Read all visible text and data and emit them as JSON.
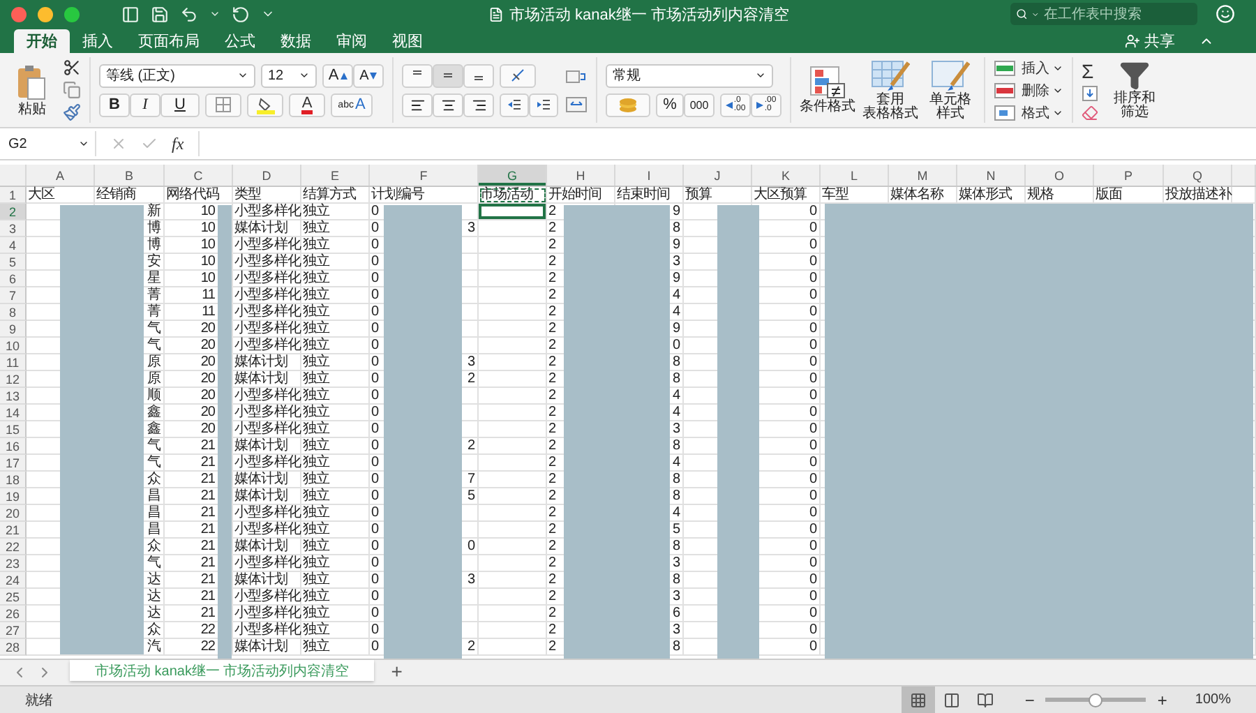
{
  "window": {
    "title": "市场活动 kanak继一 市场活动列内容清空"
  },
  "search": {
    "placeholder": "在工作表中搜索"
  },
  "ribbon_tabs": [
    {
      "label": "开始",
      "selected": true
    },
    {
      "label": "插入",
      "selected": false
    },
    {
      "label": "页面布局",
      "selected": false
    },
    {
      "label": "公式",
      "selected": false
    },
    {
      "label": "数据",
      "selected": false
    },
    {
      "label": "审阅",
      "selected": false
    },
    {
      "label": "视图",
      "selected": false
    }
  ],
  "share": {
    "label": "共享"
  },
  "clipboard": {
    "paste": "粘贴"
  },
  "font": {
    "name": "等线 (正文)",
    "size": "12",
    "grow_letter": "A",
    "shrink_letter": "A",
    "bold": "B",
    "italic": "I",
    "underline": "U",
    "color_letter": "A",
    "phonetic": "abc",
    "phonetic_letter": "A"
  },
  "number": {
    "format": "常规",
    "percent": "%",
    "comma": "000",
    "increase_decimal": [
      ".0",
      ".00"
    ],
    "decrease_decimal": [
      ".00",
      ".0"
    ]
  },
  "styles": [
    {
      "lines": [
        "条件格式"
      ],
      "kind": "conditional"
    },
    {
      "lines": [
        "套用",
        "表格格式"
      ],
      "kind": "table"
    },
    {
      "lines": [
        "单元格",
        "样式"
      ],
      "kind": "cell"
    }
  ],
  "cells_group": [
    {
      "label": "插入",
      "kind": "insert"
    },
    {
      "label": "删除",
      "kind": "delete"
    },
    {
      "label": "格式",
      "kind": "format"
    }
  ],
  "editing": {
    "sum": "Σ",
    "sort_filter": [
      "排序和",
      "筛选"
    ]
  },
  "formula_bar": {
    "name_box": "G2",
    "fx": "fx"
  },
  "columns": [
    {
      "letter": "A",
      "kind": "text",
      "selected": false
    },
    {
      "letter": "B",
      "kind": "text",
      "selected": false
    },
    {
      "letter": "C",
      "kind": "number",
      "selected": false
    },
    {
      "letter": "D",
      "kind": "text",
      "selected": false
    },
    {
      "letter": "E",
      "kind": "text",
      "selected": false
    },
    {
      "letter": "F",
      "kind": "text",
      "selected": false
    },
    {
      "letter": "G",
      "kind": "text",
      "selected": true
    },
    {
      "letter": "H",
      "kind": "text",
      "selected": false
    },
    {
      "letter": "I",
      "kind": "number",
      "selected": false
    },
    {
      "letter": "J",
      "kind": "text",
      "selected": false
    },
    {
      "letter": "K",
      "kind": "number",
      "selected": false
    },
    {
      "letter": "L",
      "kind": "text",
      "selected": false
    },
    {
      "letter": "M",
      "kind": "text",
      "selected": false
    },
    {
      "letter": "N",
      "kind": "text",
      "selected": false
    },
    {
      "letter": "O",
      "kind": "text",
      "selected": false
    },
    {
      "letter": "P",
      "kind": "text",
      "selected": false
    },
    {
      "letter": "Q",
      "kind": "text",
      "selected": false
    }
  ],
  "rows": [
    {
      "row": "1",
      "selected": false,
      "cells": [
        "大区",
        "经销商",
        "网络代码",
        "类型",
        "结算方式",
        "计划编号",
        "市场活动",
        "开始时间",
        "结束时间",
        "预算",
        "大区预算",
        "车型",
        "媒体名称",
        "媒体形式",
        "规格",
        "版面",
        "投放描述补"
      ]
    },
    {
      "row": "2",
      "selected": true,
      "cells": [
        null,
        "新",
        "10",
        "小型多样化",
        "独立",
        "0",
        null,
        "2",
        "9",
        null,
        "0"
      ]
    },
    {
      "row": "3",
      "selected": false,
      "cells": [
        null,
        "博",
        "10",
        "媒体计划",
        "独立",
        "0",
        null,
        "2",
        "8",
        null,
        "0"
      ],
      "plan_code_tail": "3"
    },
    {
      "row": "4",
      "selected": false,
      "cells": [
        null,
        "博",
        "10",
        "小型多样化",
        "独立",
        "0",
        null,
        "2",
        "9",
        null,
        "0"
      ]
    },
    {
      "row": "5",
      "selected": false,
      "cells": [
        null,
        "安",
        "10",
        "小型多样化",
        "独立",
        "0",
        null,
        "2",
        "3",
        null,
        "0"
      ]
    },
    {
      "row": "6",
      "selected": false,
      "cells": [
        null,
        "星",
        "10",
        "小型多样化",
        "独立",
        "0",
        null,
        "2",
        "9",
        null,
        "0"
      ]
    },
    {
      "row": "7",
      "selected": false,
      "cells": [
        null,
        "菁",
        "11",
        "小型多样化",
        "独立",
        "0",
        null,
        "2",
        "4",
        null,
        "0"
      ]
    },
    {
      "row": "8",
      "selected": false,
      "cells": [
        null,
        "菁",
        "11",
        "小型多样化",
        "独立",
        "0",
        null,
        "2",
        "4",
        null,
        "0"
      ]
    },
    {
      "row": "9",
      "selected": false,
      "cells": [
        null,
        "气",
        "20",
        "小型多样化",
        "独立",
        "0",
        null,
        "2",
        "9",
        null,
        "0"
      ]
    },
    {
      "row": "10",
      "selected": false,
      "cells": [
        null,
        "气",
        "20",
        "小型多样化",
        "独立",
        "0",
        null,
        "2",
        "0",
        null,
        "0"
      ]
    },
    {
      "row": "11",
      "selected": false,
      "cells": [
        null,
        "原",
        "20",
        "媒体计划",
        "独立",
        "0",
        null,
        "2",
        "8",
        null,
        "0"
      ],
      "plan_code_tail": "3"
    },
    {
      "row": "12",
      "selected": false,
      "cells": [
        null,
        "原",
        "20",
        "媒体计划",
        "独立",
        "0",
        null,
        "2",
        "8",
        null,
        "0"
      ],
      "plan_code_tail": "2"
    },
    {
      "row": "13",
      "selected": false,
      "cells": [
        null,
        "顺",
        "20",
        "小型多样化",
        "独立",
        "0",
        null,
        "2",
        "4",
        null,
        "0"
      ]
    },
    {
      "row": "14",
      "selected": false,
      "cells": [
        null,
        "鑫",
        "20",
        "小型多样化",
        "独立",
        "0",
        null,
        "2",
        "4",
        null,
        "0"
      ]
    },
    {
      "row": "15",
      "selected": false,
      "cells": [
        null,
        "鑫",
        "20",
        "小型多样化",
        "独立",
        "0",
        null,
        "2",
        "3",
        null,
        "0"
      ]
    },
    {
      "row": "16",
      "selected": false,
      "cells": [
        null,
        "气",
        "21",
        "媒体计划",
        "独立",
        "0",
        null,
        "2",
        "8",
        null,
        "0"
      ],
      "plan_code_tail": "2"
    },
    {
      "row": "17",
      "selected": false,
      "cells": [
        null,
        "气",
        "21",
        "小型多样化",
        "独立",
        "0",
        null,
        "2",
        "4",
        null,
        "0"
      ]
    },
    {
      "row": "18",
      "selected": false,
      "cells": [
        null,
        "众",
        "21",
        "媒体计划",
        "独立",
        "0",
        null,
        "2",
        "8",
        null,
        "0"
      ],
      "plan_code_tail": "7"
    },
    {
      "row": "19",
      "selected": false,
      "cells": [
        null,
        "昌",
        "21",
        "媒体计划",
        "独立",
        "0",
        null,
        "2",
        "8",
        null,
        "0"
      ],
      "plan_code_tail": "5"
    },
    {
      "row": "20",
      "selected": false,
      "cells": [
        null,
        "昌",
        "21",
        "小型多样化",
        "独立",
        "0",
        null,
        "2",
        "4",
        null,
        "0"
      ]
    },
    {
      "row": "21",
      "selected": false,
      "cells": [
        null,
        "昌",
        "21",
        "小型多样化",
        "独立",
        "0",
        null,
        "2",
        "5",
        null,
        "0"
      ]
    },
    {
      "row": "22",
      "selected": false,
      "cells": [
        null,
        "众",
        "21",
        "媒体计划",
        "独立",
        "0",
        null,
        "2",
        "8",
        null,
        "0"
      ],
      "plan_code_tail": "0"
    },
    {
      "row": "23",
      "selected": false,
      "cells": [
        null,
        "气",
        "21",
        "小型多样化",
        "独立",
        "0",
        null,
        "2",
        "3",
        null,
        "0"
      ]
    },
    {
      "row": "24",
      "selected": false,
      "cells": [
        null,
        "达",
        "21",
        "媒体计划",
        "独立",
        "0",
        null,
        "2",
        "8",
        null,
        "0"
      ],
      "plan_code_tail": "3"
    },
    {
      "row": "25",
      "selected": false,
      "cells": [
        null,
        "达",
        "21",
        "小型多样化",
        "独立",
        "0",
        null,
        "2",
        "3",
        null,
        "0"
      ]
    },
    {
      "row": "26",
      "selected": false,
      "cells": [
        null,
        "达",
        "21",
        "小型多样化",
        "独立",
        "0",
        null,
        "2",
        "6",
        null,
        "0"
      ]
    },
    {
      "row": "27",
      "selected": false,
      "cells": [
        null,
        "众",
        "22",
        "小型多样化",
        "独立",
        "0",
        null,
        "2",
        "3",
        null,
        "0"
      ]
    },
    {
      "row": "28",
      "selected": false,
      "cells": [
        null,
        "汽",
        "22",
        "媒体计划",
        "独立",
        "0",
        null,
        "2",
        "8",
        null,
        "0"
      ],
      "plan_code_tail": "2"
    }
  ],
  "sheet_tabs": [
    {
      "label": "市场活动 kanak继一 市场活动列内容清空",
      "selected": true
    }
  ],
  "add_sheet": "+",
  "status_bar": {
    "status": "就绪",
    "views": [
      {
        "kind": "normal",
        "selected": true
      },
      {
        "kind": "page_layout",
        "selected": false
      },
      {
        "kind": "page_break",
        "selected": false
      }
    ],
    "zoom_out": "−",
    "zoom_in": "+",
    "zoom": {
      "level": 0.5
    },
    "zoom_reading": "100%"
  }
}
